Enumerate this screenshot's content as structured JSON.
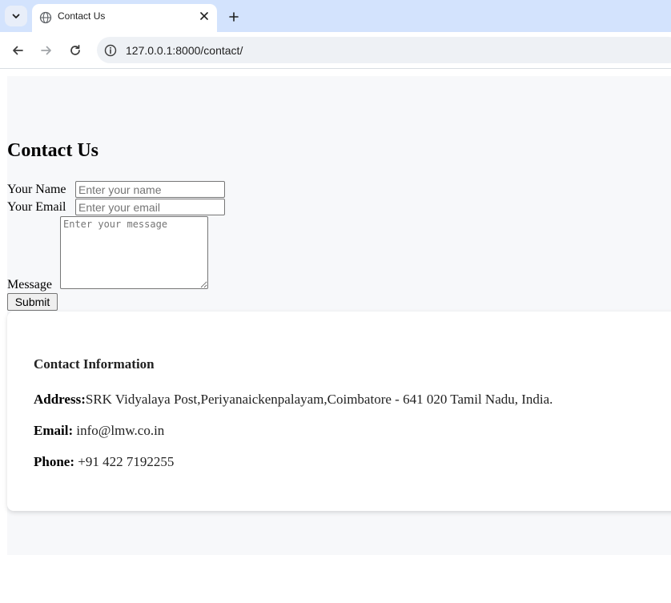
{
  "browser": {
    "tab_title": "Contact Us",
    "url": "127.0.0.1:8000/contact/"
  },
  "page": {
    "heading": "Contact Us",
    "form": {
      "name_label": "Your Name",
      "name_placeholder": "Enter your name",
      "name_value": "",
      "email_label": "Your Email",
      "email_placeholder": "Enter your email",
      "email_value": "",
      "message_label": "Message",
      "message_placeholder": "Enter your message",
      "message_value": "",
      "submit_label": "Submit"
    },
    "contact_info": {
      "title": "Contact Information",
      "address_label": "Address:",
      "address_value": "SRK Vidyalaya Post,Periyanaickenpalayam,Coimbatore - 641 020 Tamil Nadu, India.",
      "email_label": "Email:",
      "email_value": " info@lmw.co.in",
      "phone_label": "Phone:",
      "phone_value": " +91 422 7192255"
    }
  },
  "colors": {
    "tabstrip_bg": "#d3e3fd",
    "page_bg": "#f7f8fa",
    "card_bg": "#ffffff"
  },
  "icons": {
    "tab_search": "chevron-down-icon",
    "favicon": "globe-icon",
    "tab_close": "close-icon",
    "new_tab": "plus-icon",
    "back": "arrow-left-icon",
    "forward": "arrow-right-icon",
    "reload": "reload-icon",
    "site_info": "info-icon"
  }
}
